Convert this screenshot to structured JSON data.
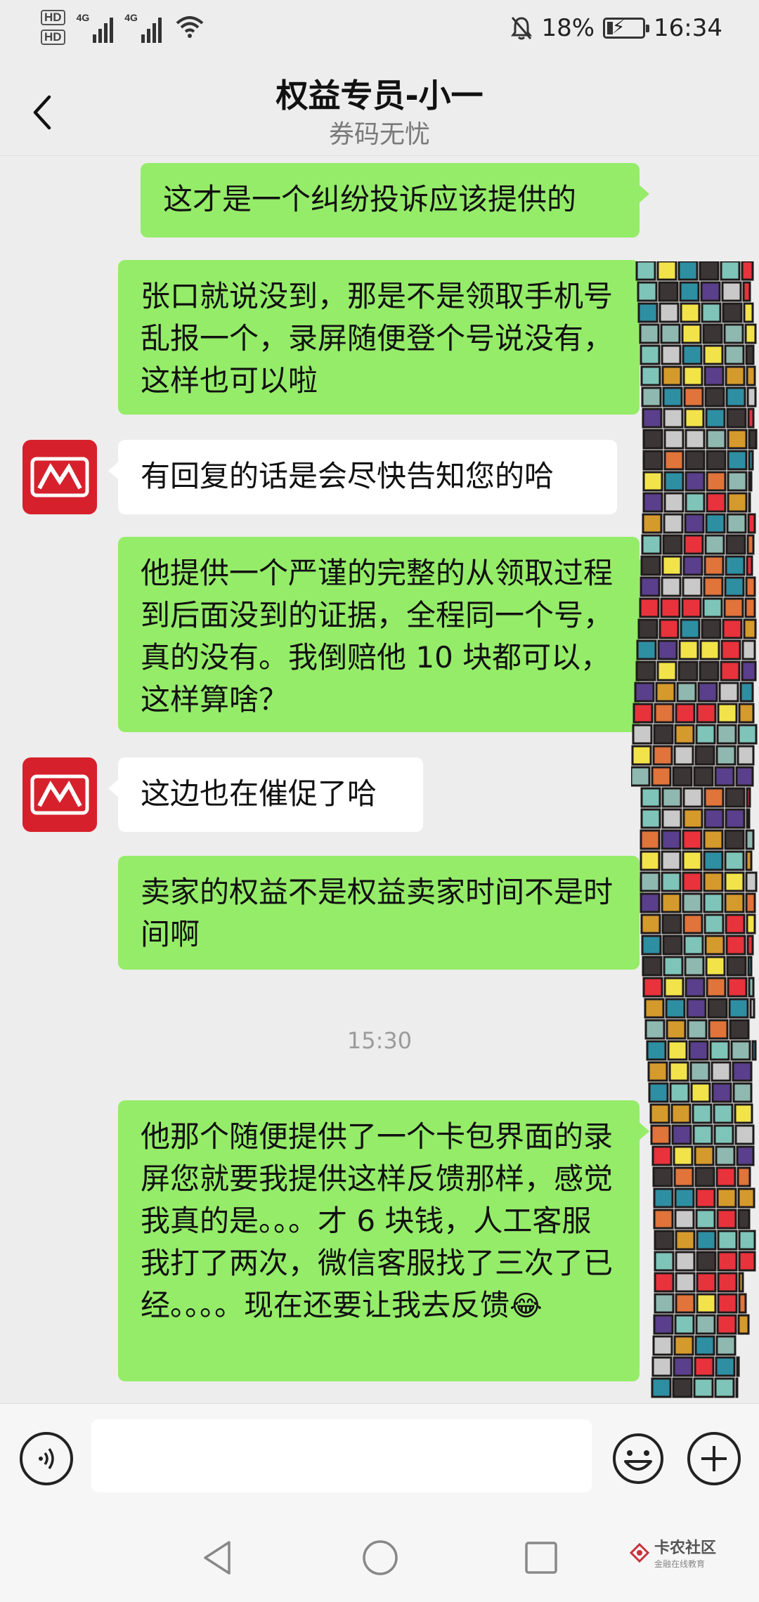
{
  "status_bar": {
    "hd1": "HD",
    "hd2": "HD",
    "net1": "4G",
    "net2": "4G",
    "battery": "18%",
    "time": "16:34"
  },
  "header": {
    "title": "权益专员-小一",
    "subtitle": "券码无忧"
  },
  "messages": [
    {
      "side": "right",
      "text": "这才是一个纠纷投诉应该提供的"
    },
    {
      "side": "right",
      "text": "张口就说没到，那是不是领取手机号乱报一个，录屏随便登个号说没有，这样也可以啦"
    },
    {
      "side": "left",
      "text": "有回复的话是会尽快告知您的哈"
    },
    {
      "side": "right",
      "text": "他提供一个严谨的完整的从领取过程到后面没到的证据，全程同一个号，真的没有。我倒赔他 10 块都可以，这样算啥？"
    },
    {
      "side": "left",
      "text": "这边也在催促了哈"
    },
    {
      "side": "right",
      "text": "卖家的权益不是权益卖家时间不是时间啊"
    },
    {
      "side": "right",
      "text": "他那个随便提供了一个卡包界面的录屏您就要我提供这样反馈那样，感觉我真的是。。。才 6 块钱，人工客服我打了两次，微信客服找了三次了已经。。。。现在还要让我去反馈",
      "emoji": "😂"
    }
  ],
  "timestamp": "15:30",
  "input": {
    "value": "",
    "placeholder": ""
  },
  "watermark": {
    "main": "卡农社区",
    "sub": "金融在线教育"
  },
  "colors": {
    "bubble_right": "#95ec69",
    "bubble_left": "#ffffff",
    "avatar": "#d6212c",
    "background": "#ededed"
  }
}
